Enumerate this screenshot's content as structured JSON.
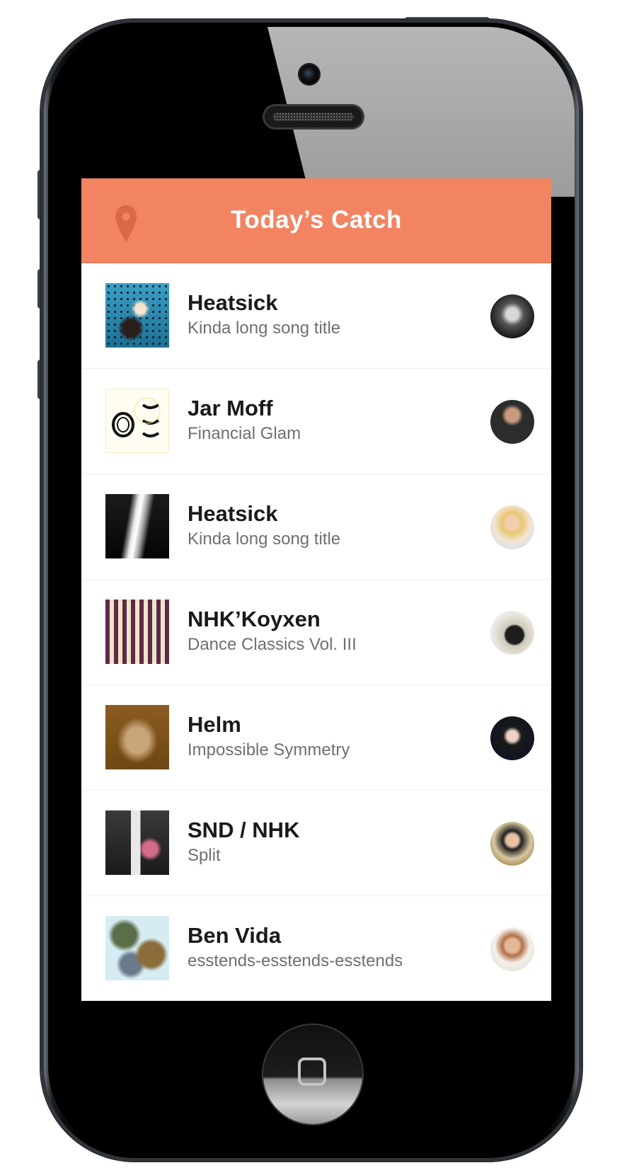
{
  "header": {
    "title": "Today’s Catch",
    "icon": "location-pin-icon",
    "background_color": "#f28462",
    "text_color": "#ffffff"
  },
  "tracks": [
    {
      "artist": "Heatsick",
      "title": "Kinda long song title"
    },
    {
      "artist": "Jar Moff",
      "title": "Financial Glam"
    },
    {
      "artist": "Heatsick",
      "title": "Kinda long song title"
    },
    {
      "artist": "NHK’Koyxen",
      "title": "Dance Classics Vol. III"
    },
    {
      "artist": "Helm",
      "title": "Impossible Symmetry"
    },
    {
      "artist": "SND / NHK",
      "title": "Split"
    },
    {
      "artist": "Ben Vida",
      "title": "esstends-esstends-esstends"
    }
  ],
  "colors": {
    "artist_text": "#1a1a1a",
    "title_text": "#6f6f6f",
    "divider": "#efefef"
  }
}
